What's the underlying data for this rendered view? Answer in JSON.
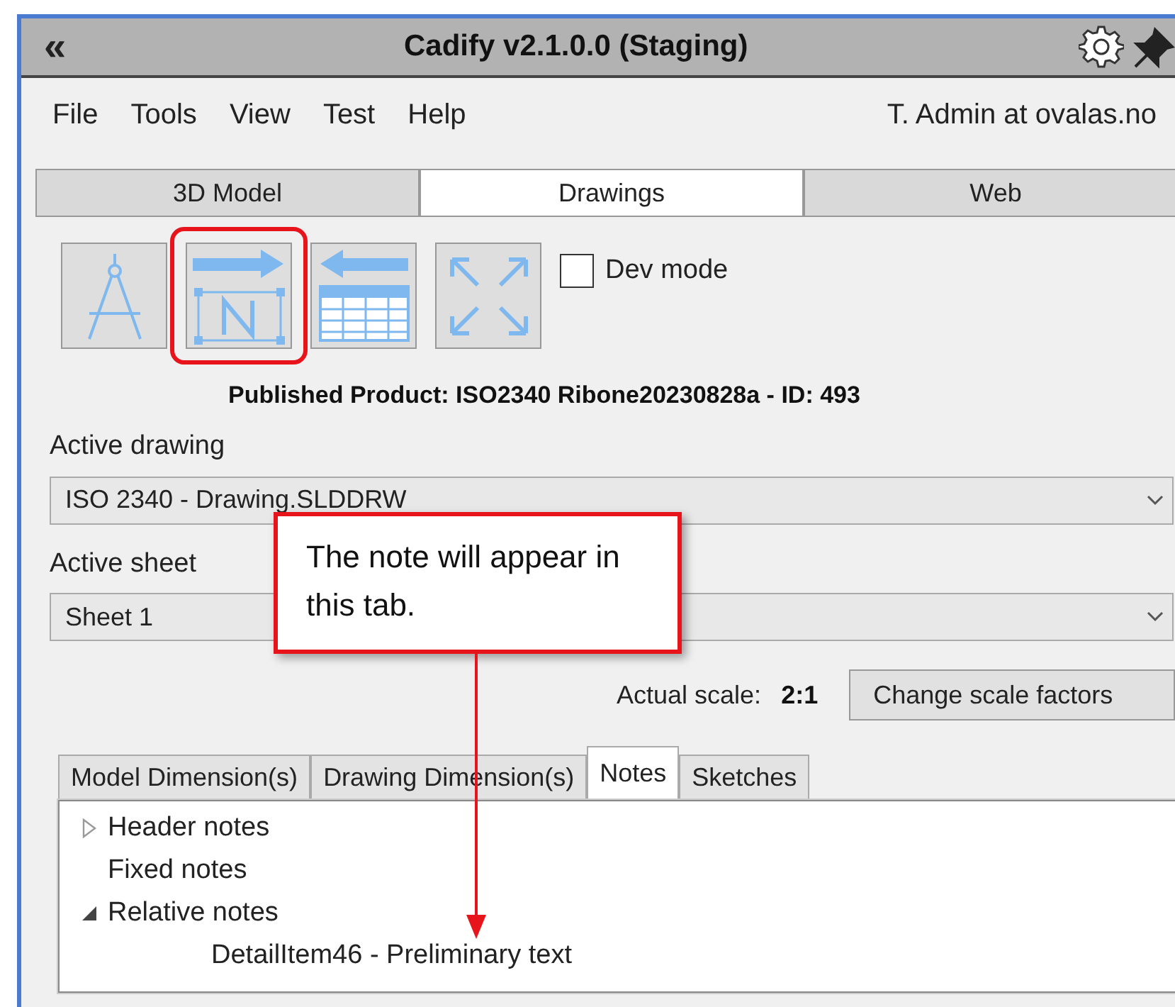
{
  "window": {
    "title": "Cadify v2.1.0.0 (Staging)",
    "collapse_glyph": "«"
  },
  "menu": [
    "File",
    "Tools",
    "View",
    "Test",
    "Help"
  ],
  "user": "T. Admin at ovalas.no",
  "tabs": [
    {
      "label": "3D Model",
      "selected": false
    },
    {
      "label": "Drawings",
      "selected": true
    },
    {
      "label": "Web",
      "selected": false
    }
  ],
  "toolbar": [
    {
      "kind": "compass",
      "highlighted": false
    },
    {
      "kind": "note",
      "highlighted": true
    },
    {
      "kind": "table",
      "highlighted": false
    },
    {
      "kind": "expand",
      "highlighted": false
    }
  ],
  "dev_mode": {
    "label": "Dev mode",
    "checked": false
  },
  "published": "Published Product: ISO2340 Ribone20230828a - ID: 493",
  "active_drawing": {
    "label": "Active drawing",
    "value": "ISO 2340 - Drawing.SLDDRW"
  },
  "active_sheet": {
    "label": "Active sheet",
    "value": "Sheet 1"
  },
  "scale": {
    "label": "Actual scale:",
    "value": "2:1",
    "button": "Change scale factors"
  },
  "sub_tabs": [
    {
      "label": "Model Dimension(s)",
      "selected": false
    },
    {
      "label": "Drawing Dimension(s)",
      "selected": false
    },
    {
      "label": "Notes",
      "selected": true
    },
    {
      "label": "Sketches",
      "selected": false
    }
  ],
  "tree": [
    {
      "label": "Header notes",
      "expanded": false
    },
    {
      "label": "Fixed notes"
    },
    {
      "label": "Relative notes",
      "expanded": true,
      "children": [
        {
          "label": "DetailItem46 - Preliminary text"
        }
      ]
    }
  ],
  "callout": {
    "text": "The note will appear in this tab."
  }
}
